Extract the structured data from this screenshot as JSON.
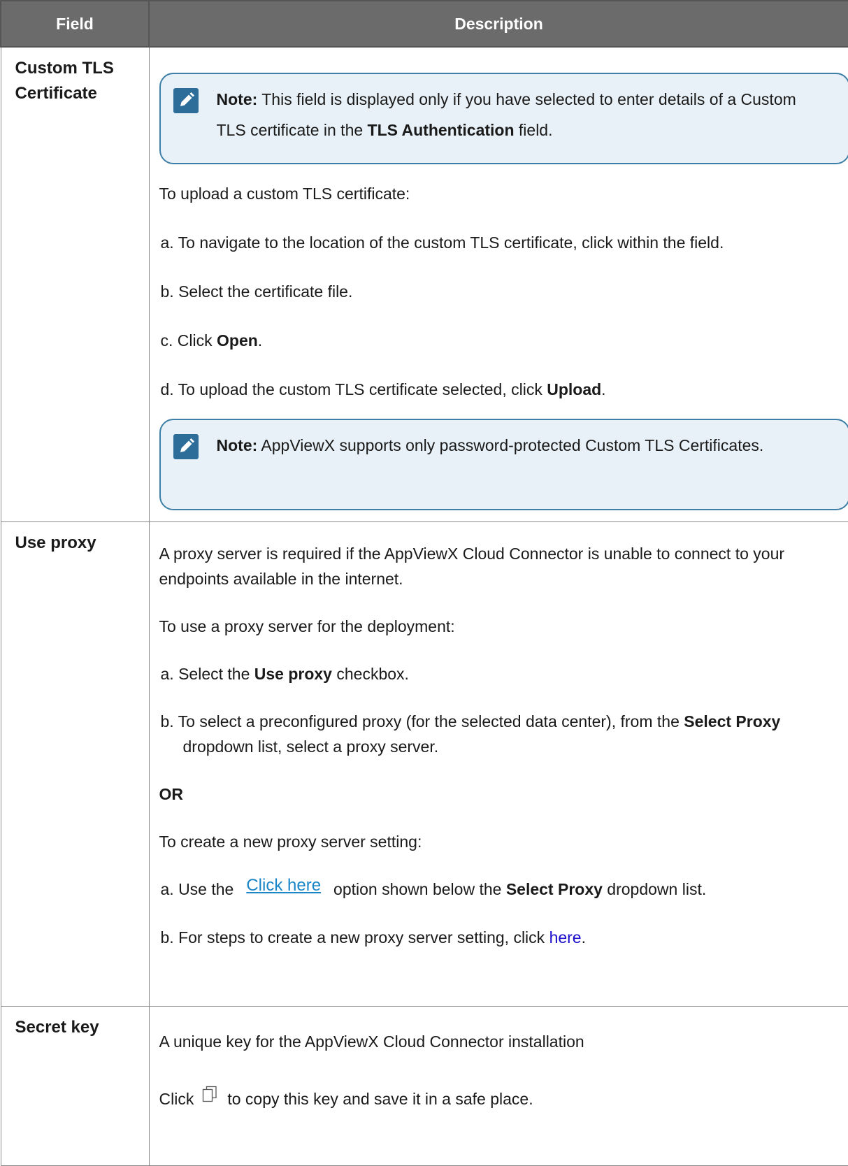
{
  "header": {
    "col_field": "Field",
    "col_description": "Description"
  },
  "rows": {
    "tls": {
      "field": "Custom TLS Certificate",
      "note1": {
        "label": "Note:",
        "text_a": " This field is displayed only if you have selected to enter details of a Custom TLS certificate in the ",
        "bold": "TLS Authentication",
        "text_b": " field."
      },
      "intro": "To upload a custom TLS certificate:",
      "step_a": "a. To navigate to the location of the custom TLS certificate, click within the field.",
      "step_b": "b. Select the certificate file.",
      "step_c": {
        "pre": "c. Click ",
        "bold": "Open",
        "post": "."
      },
      "step_d": {
        "pre": "d. To upload the custom TLS certificate selected, click ",
        "bold": "Upload",
        "post": "."
      },
      "note2": {
        "label": "Note:",
        "text": " AppViewX supports only password-protected Custom TLS Certificates."
      },
      "note_icon": "pencil-note-icon"
    },
    "proxy": {
      "field": "Use proxy",
      "intro": "A proxy server is required if the AppViewX Cloud Connector is unable to connect to your endpoints available in the internet.",
      "usage": "To use a proxy server for the deployment:",
      "step_a": {
        "pre": "a. Select the ",
        "bold": "Use proxy",
        "post": " checkbox."
      },
      "step_b": {
        "pre": "b. To select a preconfigured proxy (for the selected data center), from the ",
        "bold": "Select Proxy",
        "post": " dropdown list, select a proxy server."
      },
      "or": "OR",
      "create": "To create a new proxy server setting:",
      "step_a2": {
        "pre": "a. Use the",
        "link": "Click here",
        "mid": "option shown below the ",
        "bold": "Select Proxy",
        "post": " dropdown list."
      },
      "step_b2": {
        "pre": "b. For steps to create a new proxy server setting, click ",
        "link": "here",
        "post": "."
      }
    },
    "secret": {
      "field": "Secret key",
      "desc": "A unique key for the AppViewX Cloud Connector installation",
      "copy_pre": "Click",
      "copy_post": "to copy this key and save it in a safe place.",
      "copy_icon": "copy-icon"
    }
  }
}
